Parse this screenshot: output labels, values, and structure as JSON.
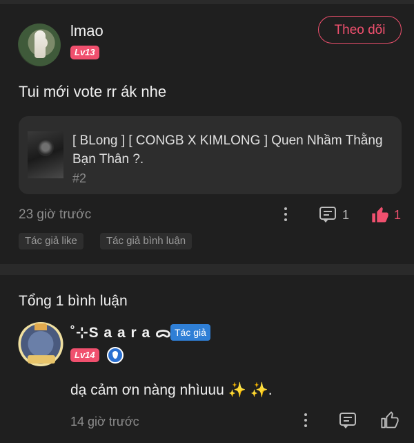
{
  "post": {
    "username": "lmao",
    "level": "Lv13",
    "follow_label": "Theo dõi",
    "text": "Tui mới vote rr ák nhe",
    "linked_card": {
      "title": "[ BLong ] [ CONGB X KIMLONG ] Quen Nhầm Thằng Bạn Thân ?.",
      "subtitle": "#2"
    },
    "time": "23 giờ trước",
    "comment_count": "1",
    "like_count": "1",
    "tags": [
      "Tác giả like",
      "Tác giả bình luận"
    ]
  },
  "comments_section": {
    "total_label": "Tổng 1 bình luận"
  },
  "comment": {
    "username": "˚⊹S a a r a ᯅ.",
    "author_tag": "Tác giả",
    "level": "Lv14",
    "text_main": "dạ cảm ơn nàng nhìuuu",
    "text_sparkles": "✨ ✨",
    "text_end": ".",
    "time": "14 giờ trước"
  },
  "colors": {
    "accent": "#f0506e",
    "author_tag": "#2f7fd6",
    "background": "#1f1f1f"
  }
}
